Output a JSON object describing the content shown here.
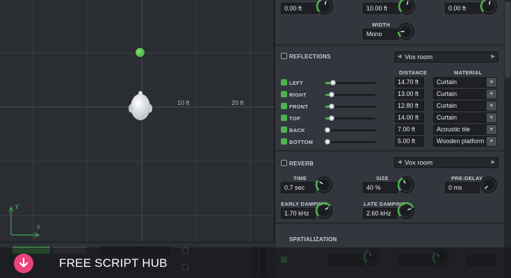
{
  "viewport": {
    "distance_labels": [
      "10 ft",
      "20 ft"
    ],
    "axis_y": "y",
    "axis_x": "x"
  },
  "source": {
    "params": [
      {
        "value": "0.00 ft",
        "level": 0.55
      },
      {
        "value": "10.00 ft",
        "level": 0.55
      },
      {
        "value": "0.00 ft",
        "level": 0.55
      }
    ],
    "width": {
      "label": "WIDTH",
      "value": "Mono",
      "level": 0.15
    }
  },
  "reflections": {
    "title": "REFLECTIONS",
    "enabled": false,
    "preset": "Vox room",
    "distance_header": "DISTANCE",
    "material_header": "MATERIAL",
    "rows": [
      {
        "label": "LEFT",
        "enabled": true,
        "distance": "14.70 ft",
        "material": "Curtain",
        "level": 0.12
      },
      {
        "label": "RIGHT",
        "enabled": true,
        "distance": "13.00 ft",
        "material": "Curtain",
        "level": 0.1
      },
      {
        "label": "FRONT",
        "enabled": true,
        "distance": "12.80 ft",
        "material": "Curtain",
        "level": 0.1
      },
      {
        "label": "TOP",
        "enabled": true,
        "distance": "14.00 ft",
        "material": "Curtain",
        "level": 0.1
      },
      {
        "label": "BACK",
        "enabled": true,
        "distance": "7.00 ft",
        "material": "Acoustic tile",
        "level": 0.02
      },
      {
        "label": "BOTTOM",
        "enabled": true,
        "distance": "5.00 ft",
        "material": "Wooden platform",
        "level": 0.02
      }
    ]
  },
  "reverb": {
    "title": "REVERB",
    "enabled": false,
    "preset": "Vox room",
    "time": {
      "label": "TIME",
      "value": "0.7 sec",
      "level": 0.3
    },
    "size": {
      "label": "SIZE",
      "value": "40 %",
      "level": 0.4
    },
    "predelay": {
      "label": "PRE-DELAY",
      "value": "0 ms",
      "level": 0.0
    },
    "early_damping": {
      "label": "EARLY DAMPING",
      "value": "1.70 kHz",
      "level": 0.7
    },
    "late_damping": {
      "label": "LATE DAMPING",
      "value": "2.60 kHz",
      "level": 0.75
    }
  },
  "spatialization": {
    "title": "SPATIALIZATION"
  },
  "watermark": {
    "text": "FREE SCRIPT HUB"
  },
  "colors": {
    "accent": "#4db34f",
    "panel": "#33373d",
    "viewport": "#2a2e33",
    "watermark_icon": "#e9427d"
  }
}
